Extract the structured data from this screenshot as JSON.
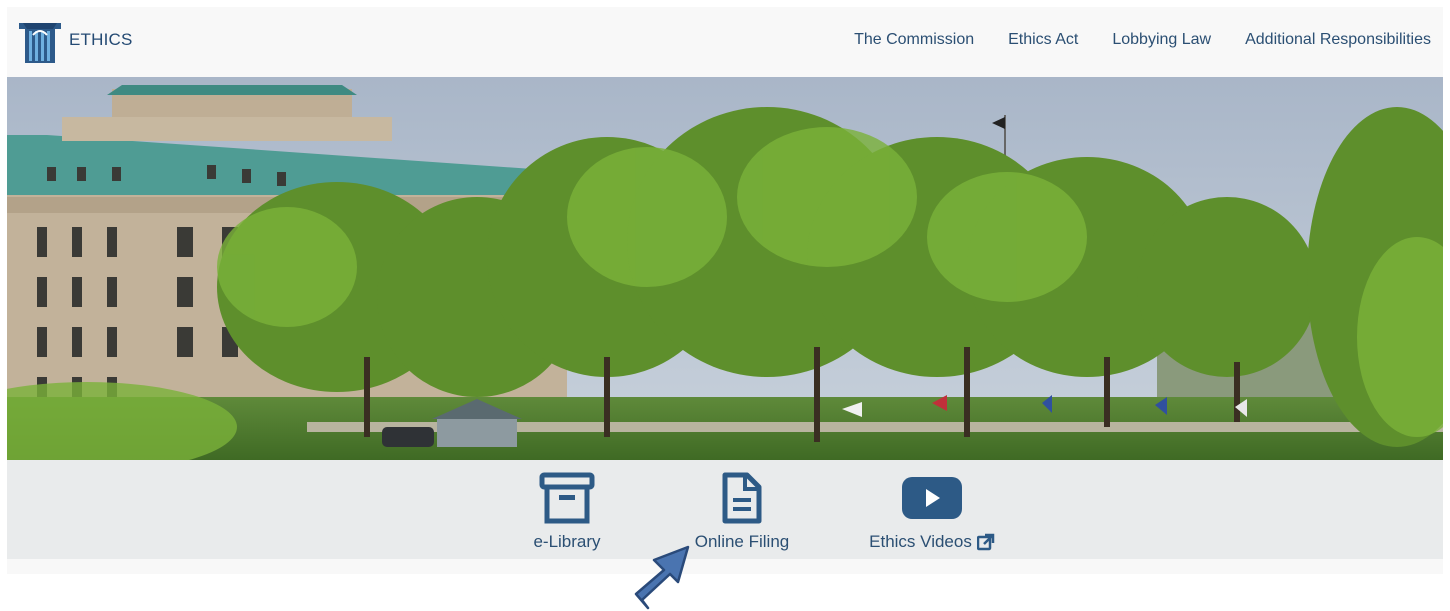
{
  "brand": {
    "name": "ETHICS",
    "logo_icon": "keystone-logo-icon",
    "color": "#244a73"
  },
  "nav": {
    "items": [
      {
        "label": "The Commission"
      },
      {
        "label": "Ethics Act"
      },
      {
        "label": "Lobbying Law"
      },
      {
        "label": "Additional Responsibilities"
      }
    ],
    "color": "#2b4f73"
  },
  "hero": {
    "icon": "capitol-building-photo"
  },
  "quick_links": {
    "items": [
      {
        "label": "e-Library",
        "icon": "archive-box-icon"
      },
      {
        "label": "Online Filing",
        "icon": "document-icon"
      },
      {
        "label": "Ethics Videos",
        "icon": "youtube-play-icon",
        "suffix_icon": "external-link-icon"
      }
    ],
    "icon_color": "#2d5a86",
    "bar_color": "#e9ebec"
  },
  "annotation": {
    "icon": "pointer-arrow-icon",
    "color": "#4a74b0"
  }
}
